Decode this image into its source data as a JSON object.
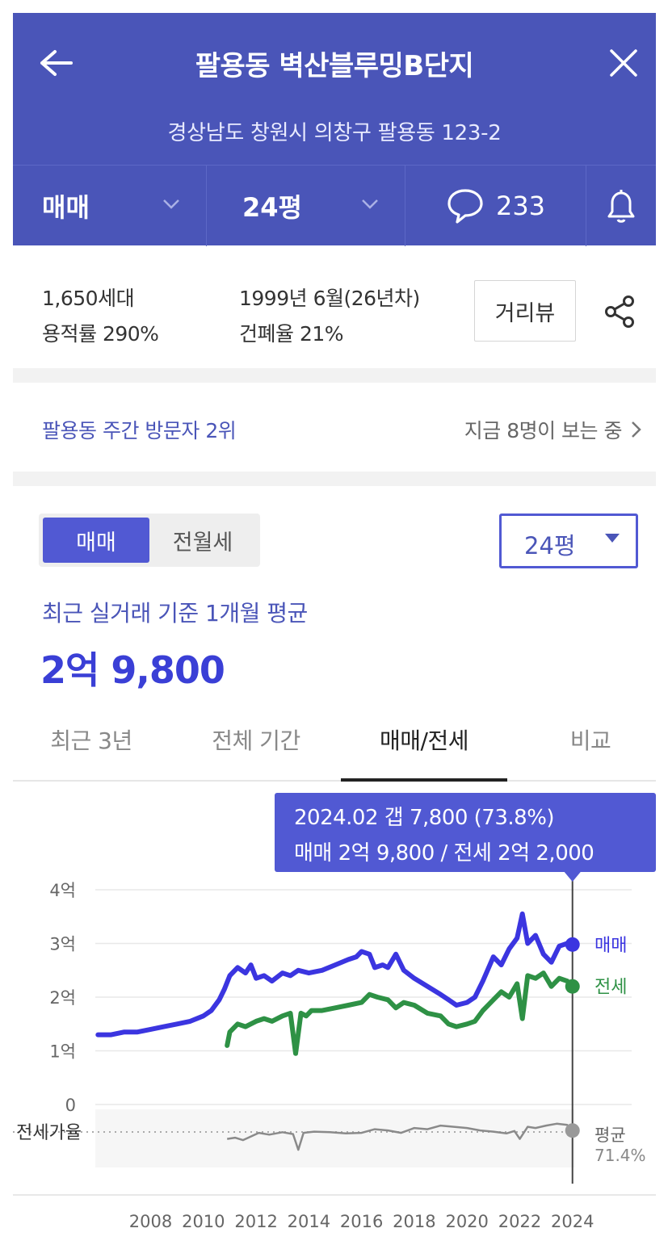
{
  "header": {
    "title": "팔용동 벽산블루밍B단지",
    "address": "경상남도 창원시 의창구 팔용동 123-2",
    "trade_type": "매매",
    "size": "24평",
    "comment_count": "233",
    "bg_color": "#4a55b8"
  },
  "info": {
    "households": "1,650세대",
    "floor_area_ratio": "용적률 290%",
    "built": "1999년 6월(26년차)",
    "coverage_ratio": "건폐율 21%",
    "street_view_label": "거리뷰"
  },
  "visitor": {
    "rank_text": "팔용동 주간 방문자 2위",
    "now_text": "지금 8명이 보는 중"
  },
  "price_section": {
    "segment": [
      "매매",
      "전월세"
    ],
    "segment_selected": "매매",
    "size_select": "24평",
    "avg_label": "최근 실거래 기준 1개월 평균",
    "avg_price": "2억 9,800",
    "tabs": [
      "최근 3년",
      "전체 기간",
      "매매/전세",
      "비교"
    ],
    "active_tab": "매매/전세"
  },
  "tooltip": {
    "line1": "2024.02  갭 7,800 (73.8%)",
    "line2": "매매 2억 9,800 / 전세 2억 2,000"
  },
  "chart_data": {
    "type": "line",
    "y_unit": "억",
    "ylim": [
      0,
      4
    ],
    "y_ticks": [
      "4억",
      "3억",
      "2억",
      "1억",
      "0"
    ],
    "x_ticks": [
      "2008",
      "2010",
      "2012",
      "2014",
      "2016",
      "2018",
      "2020",
      "2022",
      "2024"
    ],
    "xlim": [
      2005.9,
      2024.1
    ],
    "ratio_label": "전세가율",
    "ratio_avg_label": "평균",
    "ratio_avg_value": "71.4%",
    "ratio_avg": 71.4,
    "colors": {
      "sale": "#3b35e0",
      "jeonse": "#2e9145",
      "ratio": "#8a8a8a"
    },
    "series": [
      {
        "name": "매매",
        "x": [
          2006.0,
          2006.5,
          2007.0,
          2007.5,
          2008.0,
          2008.5,
          2009.0,
          2009.5,
          2010.0,
          2010.3,
          2010.6,
          2010.8,
          2011.0,
          2011.3,
          2011.6,
          2011.8,
          2012.0,
          2012.3,
          2012.6,
          2013.0,
          2013.3,
          2013.6,
          2014.0,
          2014.5,
          2015.0,
          2015.5,
          2015.8,
          2016.0,
          2016.3,
          2016.5,
          2016.8,
          2017.0,
          2017.3,
          2017.6,
          2018.0,
          2018.5,
          2019.0,
          2019.3,
          2019.6,
          2020.0,
          2020.3,
          2020.6,
          2021.0,
          2021.3,
          2021.6,
          2021.9,
          2022.1,
          2022.3,
          2022.6,
          2022.9,
          2023.2,
          2023.5,
          2023.8,
          2024.0
        ],
        "y": [
          1.3,
          1.3,
          1.35,
          1.35,
          1.4,
          1.45,
          1.5,
          1.55,
          1.65,
          1.75,
          1.95,
          2.15,
          2.4,
          2.55,
          2.45,
          2.6,
          2.35,
          2.4,
          2.3,
          2.45,
          2.4,
          2.5,
          2.45,
          2.5,
          2.6,
          2.7,
          2.75,
          2.85,
          2.8,
          2.55,
          2.6,
          2.55,
          2.8,
          2.5,
          2.35,
          2.2,
          2.05,
          1.95,
          1.85,
          1.9,
          2.0,
          2.3,
          2.75,
          2.6,
          2.9,
          3.1,
          3.55,
          3.0,
          3.15,
          2.8,
          2.65,
          2.95,
          3.0,
          2.98
        ]
      },
      {
        "name": "전세",
        "x": [
          2010.9,
          2011.0,
          2011.3,
          2011.6,
          2012.0,
          2012.3,
          2012.6,
          2013.0,
          2013.3,
          2013.5,
          2013.7,
          2013.9,
          2014.1,
          2014.5,
          2015.0,
          2015.5,
          2016.0,
          2016.3,
          2016.6,
          2017.0,
          2017.3,
          2017.6,
          2018.0,
          2018.5,
          2019.0,
          2019.3,
          2019.6,
          2020.0,
          2020.3,
          2020.6,
          2021.0,
          2021.3,
          2021.6,
          2021.9,
          2022.1,
          2022.3,
          2022.6,
          2022.9,
          2023.2,
          2023.5,
          2023.8,
          2024.0
        ],
        "y": [
          1.1,
          1.35,
          1.5,
          1.45,
          1.55,
          1.6,
          1.55,
          1.65,
          1.7,
          0.95,
          1.7,
          1.65,
          1.75,
          1.75,
          1.8,
          1.85,
          1.9,
          2.05,
          2.0,
          1.95,
          1.8,
          1.9,
          1.85,
          1.7,
          1.65,
          1.5,
          1.45,
          1.5,
          1.55,
          1.75,
          1.95,
          2.1,
          2.0,
          2.25,
          1.6,
          2.4,
          2.35,
          2.45,
          2.2,
          2.35,
          2.3,
          2.2
        ]
      },
      {
        "name": "전세가율",
        "x": [
          2010.9,
          2011.2,
          2011.5,
          2011.8,
          2012.1,
          2012.5,
          2013.0,
          2013.4,
          2013.6,
          2013.8,
          2014.2,
          2014.8,
          2015.4,
          2016.0,
          2016.5,
          2017.0,
          2017.5,
          2018.0,
          2018.5,
          2019.0,
          2019.5,
          2020.0,
          2020.5,
          2021.0,
          2021.5,
          2021.8,
          2022.0,
          2022.3,
          2022.6,
          2023.0,
          2023.4,
          2023.8,
          2024.0
        ],
        "y": [
          60,
          62,
          58,
          64,
          70,
          67,
          71,
          68,
          42,
          70,
          72,
          71,
          69,
          70,
          76,
          74,
          70,
          78,
          76,
          82,
          80,
          78,
          74,
          72,
          69,
          73,
          60,
          80,
          78,
          82,
          85,
          83,
          73.8
        ]
      }
    ]
  }
}
